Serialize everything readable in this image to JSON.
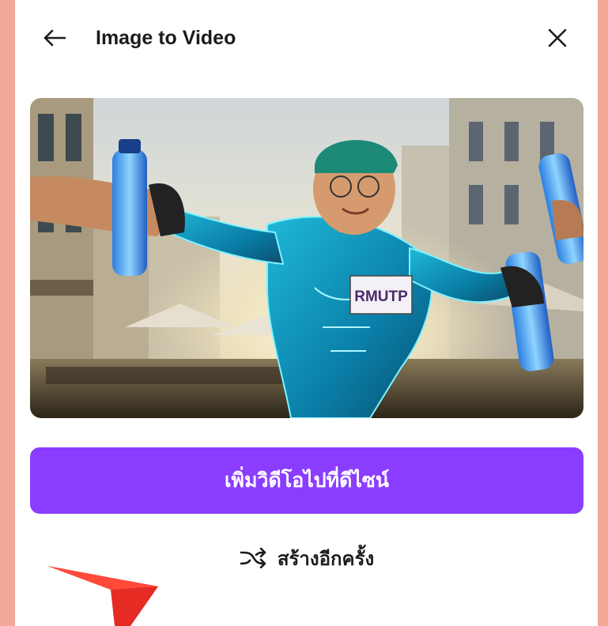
{
  "header": {
    "title": "Image to Video",
    "back_icon": "arrow-left-icon",
    "close_icon": "close-icon"
  },
  "preview": {
    "badge_text": "RMUTP"
  },
  "actions": {
    "primary_label": "เพิ่มวิดีโอไปที่ดีไซน์",
    "secondary_label": "สร้างอีกครั้ง",
    "secondary_icon": "shuffle-icon"
  },
  "colors": {
    "accent": "#8b3dff",
    "page_background": "#f2a896",
    "annotation_arrow": "#e52b23"
  }
}
